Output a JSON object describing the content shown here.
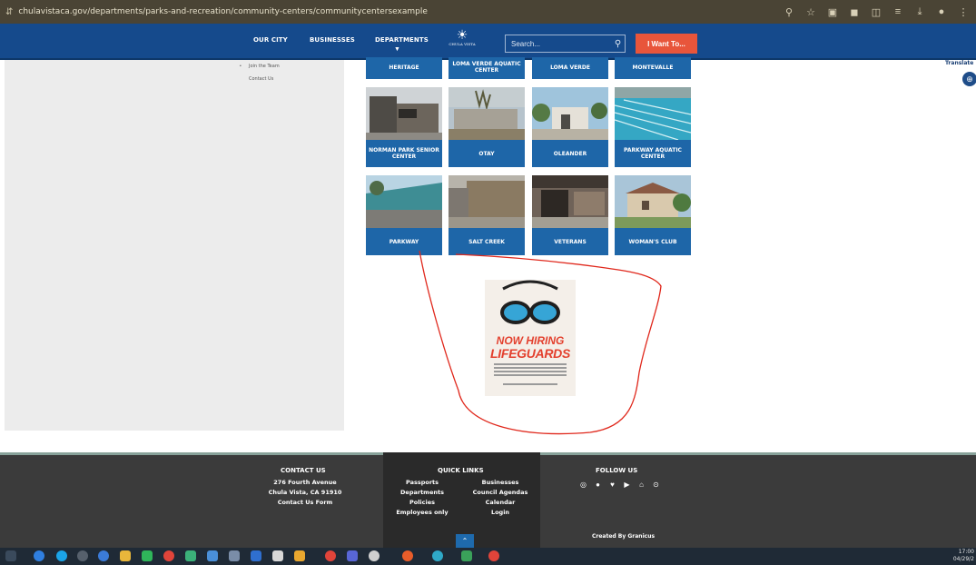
{
  "browser": {
    "url": "chulavistaca.gov/departments/parks-and-recreation/community-centers/communitycentersexample"
  },
  "nav": {
    "items": [
      "OUR CITY",
      "BUSINESSES",
      "DEPARTMENTS"
    ],
    "logo_text": "CHULA VISTA",
    "search_placeholder": "Search...",
    "iwant_label": "I Want To...",
    "translate_label": "Translate"
  },
  "sidebar": {
    "links": [
      "Join the Team",
      "Contact Us"
    ]
  },
  "centers": [
    {
      "label": "HERITAGE"
    },
    {
      "label": "LOMA VERDE AQUATIC CENTER"
    },
    {
      "label": "LOMA VERDE"
    },
    {
      "label": "MONTEVALLE"
    },
    {
      "label": "NORMAN PARK SENIOR CENTER"
    },
    {
      "label": "OTAY"
    },
    {
      "label": "OLEANDER"
    },
    {
      "label": "PARKWAY AQUATIC CENTER"
    },
    {
      "label": "PARKWAY"
    },
    {
      "label": "SALT CREEK"
    },
    {
      "label": "VETERANS"
    },
    {
      "label": "WOMAN'S CLUB"
    }
  ],
  "poster": {
    "headline_1": "NOW HIRING",
    "headline_2": "LIFEGUARDS"
  },
  "footer": {
    "contact": {
      "title": "CONTACT US",
      "address_1": "276 Fourth Avenue",
      "address_2": "Chula Vista, CA 91910",
      "form_link": "Contact Us Form"
    },
    "quick_links": {
      "title": "QUICK LINKS",
      "left": [
        "Passports",
        "Departments",
        "Policies",
        "Employees only"
      ],
      "right": [
        "Businesses",
        "Council Agendas",
        "Calendar",
        "Login"
      ]
    },
    "follow": {
      "title": "FOLLOW US",
      "icons": [
        "instagram-icon",
        "github-icon",
        "twitter-icon",
        "youtube-icon",
        "nextdoor-icon",
        "location-icon"
      ]
    },
    "credit": "Created By Granicus"
  },
  "taskbar": {
    "time": "17:00",
    "date": "04/29/2"
  }
}
